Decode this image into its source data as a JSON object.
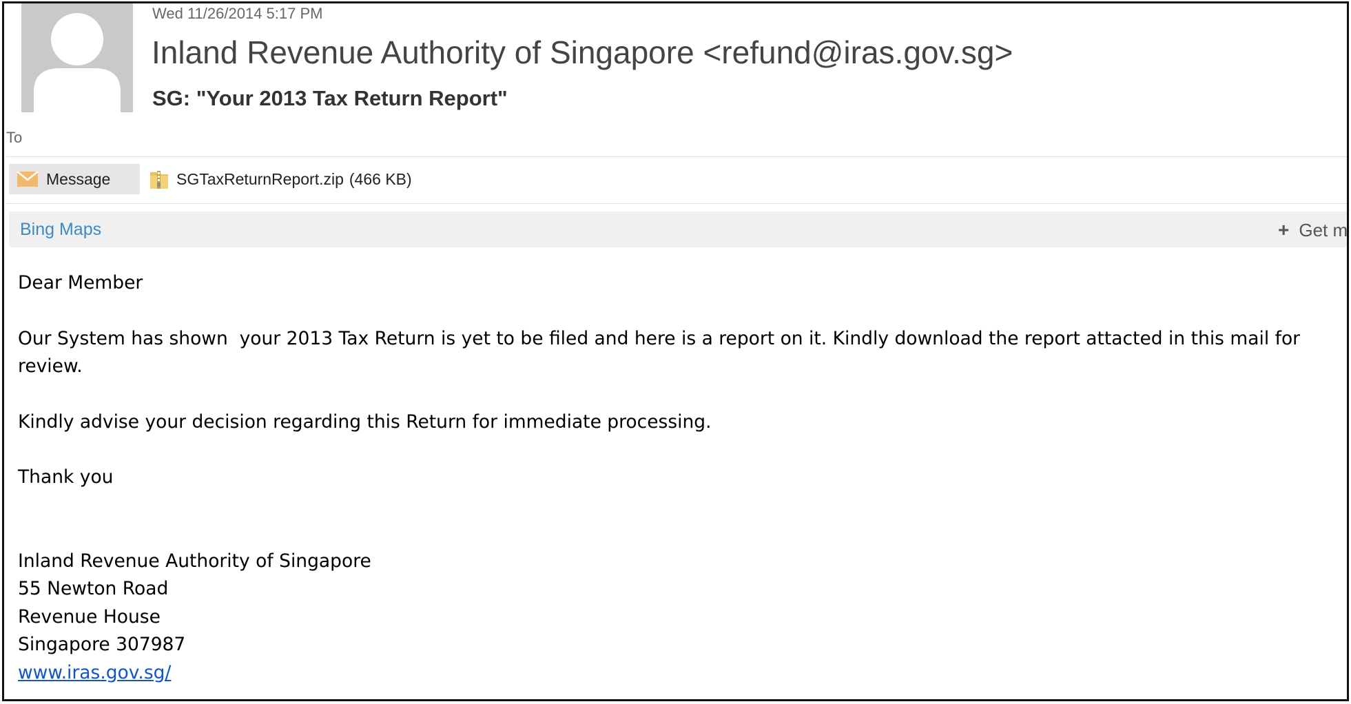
{
  "header": {
    "date": "Wed 11/26/2014 5:17 PM",
    "sender": "Inland Revenue Authority of Singapore <refund@iras.gov.sg>",
    "subject": "SG: \"Your 2013 Tax Return Report\"",
    "to_label": "To"
  },
  "attachments_bar": {
    "message_tab_label": "Message",
    "attachment_name": "SGTaxReturnReport.zip",
    "attachment_size": "(466 KB)"
  },
  "addin_bar": {
    "bing_maps_label": "Bing Maps",
    "get_more_label": "Get m"
  },
  "body": {
    "greeting": "Dear Member",
    "paragraph_1": "Our System has shown  your 2013 Tax Return is yet to be filed and here is a report on it. Kindly download the report attacted in this mail for review.",
    "paragraph_2": "Kindly advise your decision regarding this Return for immediate processing.",
    "closing": "Thank you",
    "signature": {
      "line_1": "Inland Revenue Authority of Singapore",
      "line_2": "55 Newton Road",
      "line_3": "Revenue House",
      "line_4": "Singapore 307987",
      "link": "www.iras.gov.sg/"
    }
  },
  "icons": {
    "avatar": "default-user-avatar-icon",
    "message": "envelope-icon",
    "attachment": "zip-folder-icon",
    "get_more": "plus-icon"
  },
  "colors": {
    "link_blue": "#1155cc",
    "addin_blue": "#3b8bc4",
    "avatar_bg": "#c9c9c9"
  }
}
